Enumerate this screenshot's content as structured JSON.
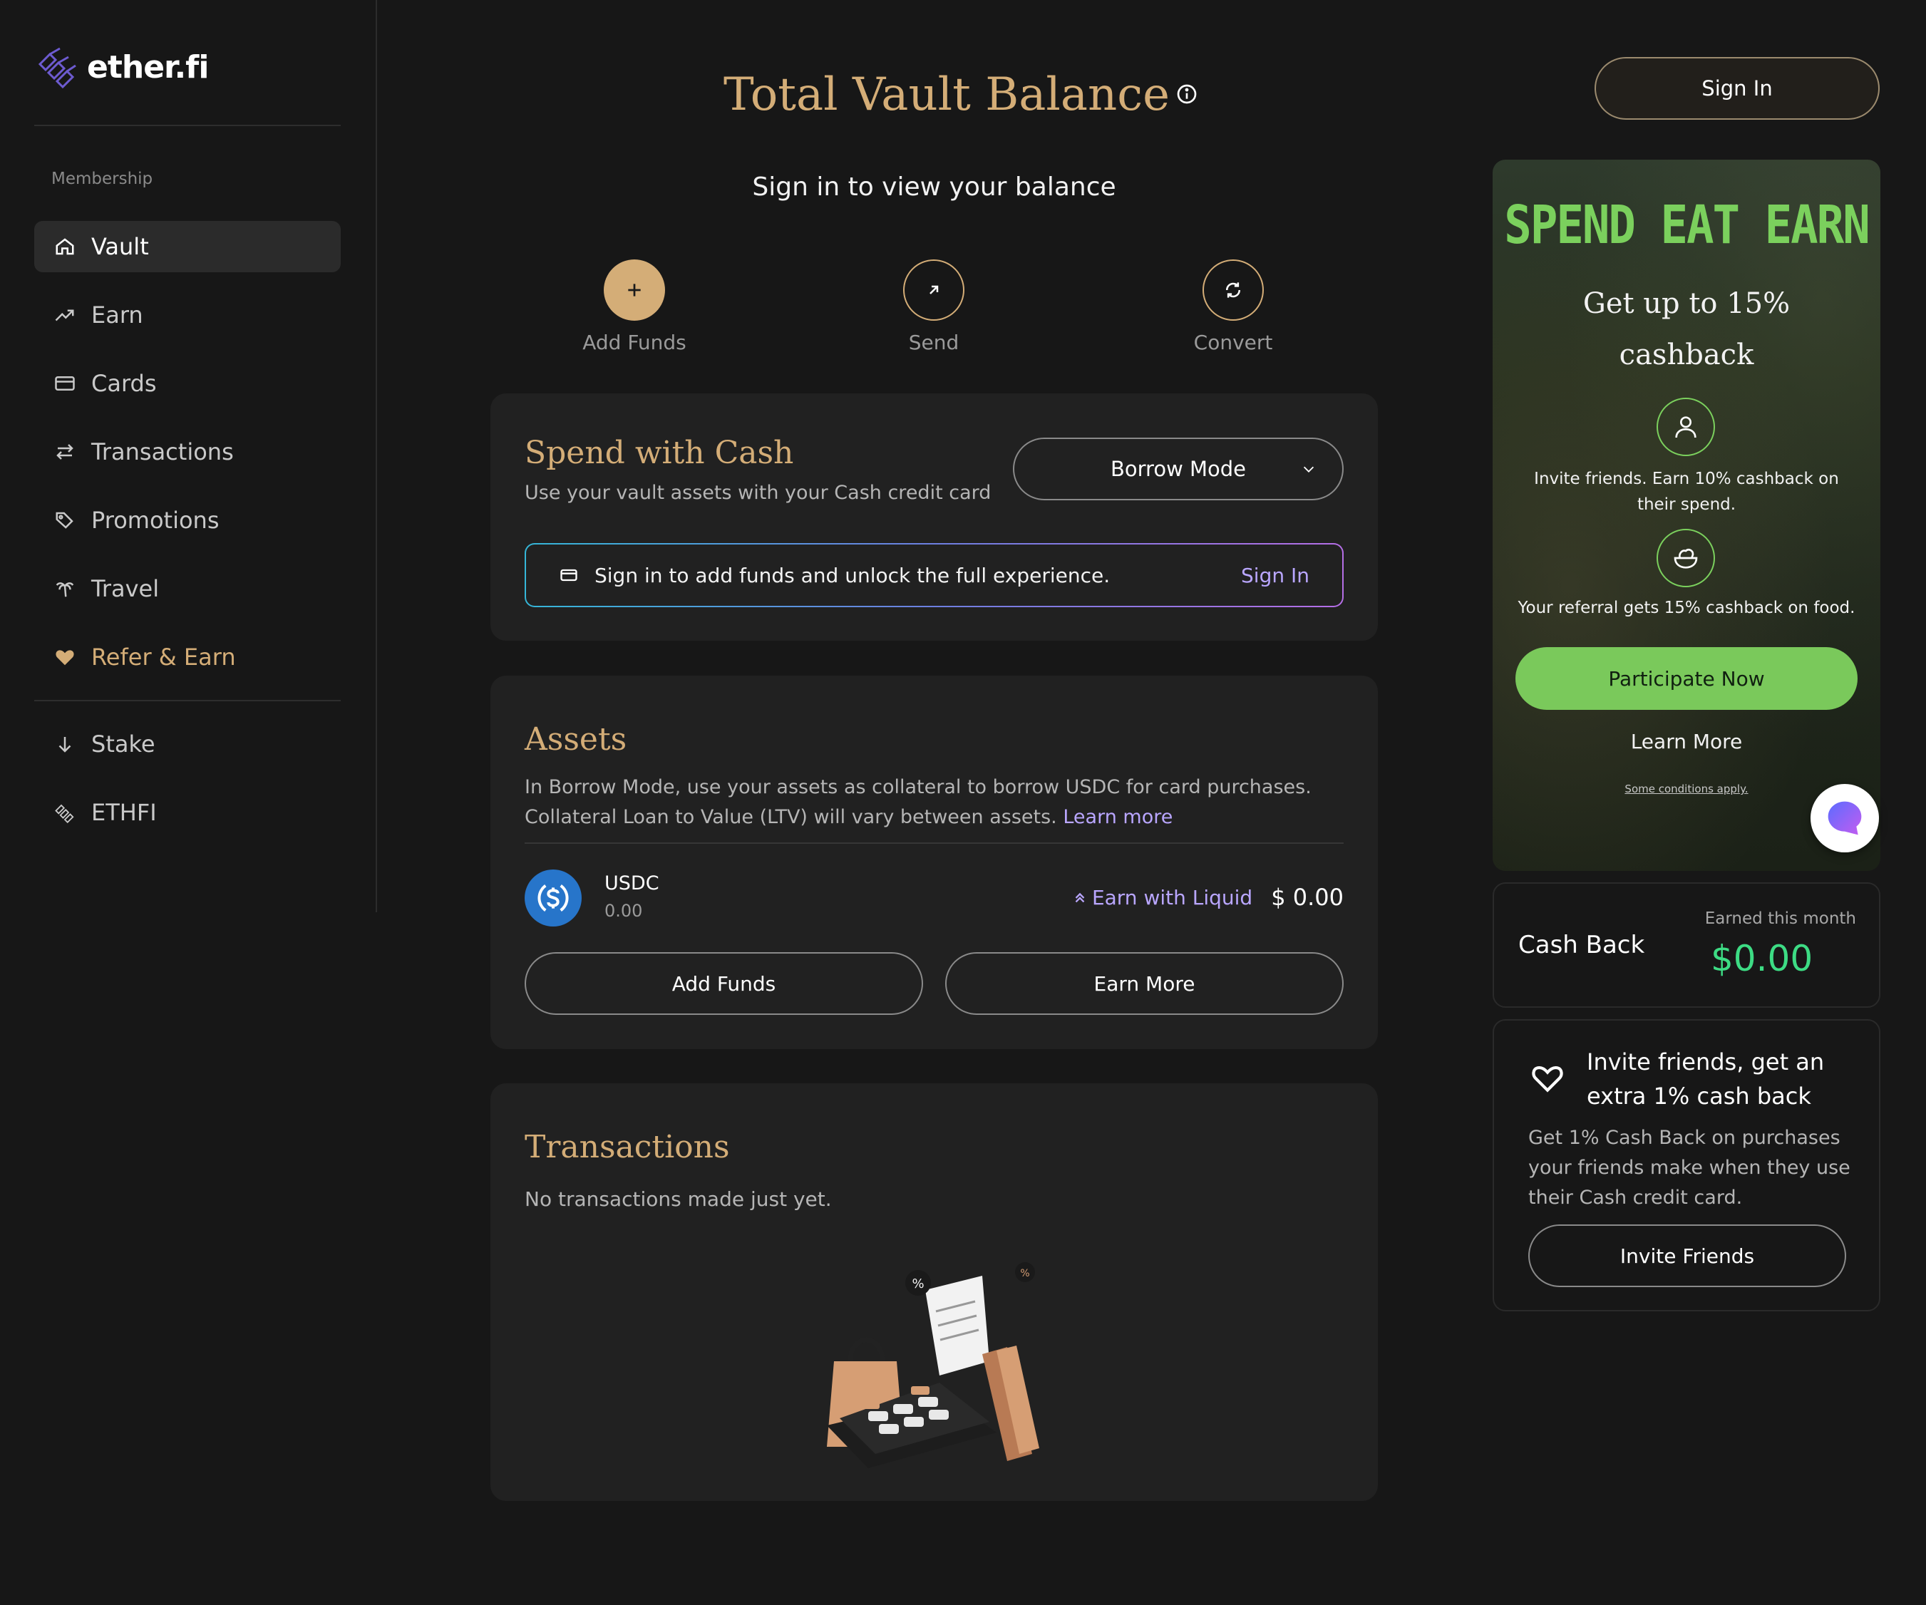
{
  "brand": {
    "name": "ether.fi"
  },
  "sidebar": {
    "section_label": "Membership",
    "items": [
      {
        "label": "Vault",
        "icon": "home-icon"
      },
      {
        "label": "Earn",
        "icon": "trending-up-icon"
      },
      {
        "label": "Cards",
        "icon": "credit-card-icon"
      },
      {
        "label": "Transactions",
        "icon": "arrows-swap-icon"
      },
      {
        "label": "Promotions",
        "icon": "tags-icon"
      },
      {
        "label": "Travel",
        "icon": "palm-tree-icon"
      },
      {
        "label": "Refer & Earn",
        "icon": "heart-icon"
      },
      {
        "label": "Stake",
        "icon": "arrow-down-icon"
      },
      {
        "label": "ETHFI",
        "icon": "ethfi-logo-icon"
      }
    ]
  },
  "header": {
    "title": "Total Vault Balance",
    "subtitle": "Sign in to view your balance",
    "sign_in": "Sign In"
  },
  "actions": [
    {
      "label": "Add Funds",
      "icon": "plus-icon"
    },
    {
      "label": "Send",
      "icon": "arrow-up-right-icon"
    },
    {
      "label": "Convert",
      "icon": "refresh-icon"
    }
  ],
  "spend": {
    "title": "Spend with Cash",
    "description": "Use your vault assets with your Cash credit card",
    "mode": "Borrow Mode",
    "banner_text": "Sign in to add funds and unlock the full experience.",
    "banner_link": "Sign In"
  },
  "assets": {
    "title": "Assets",
    "description": "In Borrow Mode, use your assets as collateral to borrow USDC for card purchases. Collateral Loan to Value (LTV) will vary between assets.",
    "learn_more": "Learn more",
    "items": [
      {
        "symbol": "USDC",
        "amount": "0.00",
        "earn_link": "Earn with Liquid",
        "value": "$ 0.00"
      }
    ],
    "add_funds": "Add Funds",
    "earn_more": "Earn More"
  },
  "transactions": {
    "title": "Transactions",
    "empty": "No transactions made just yet."
  },
  "promo": {
    "headline": "SPEND EAT EARN",
    "subhead": "Get up to 15% cashback",
    "point1": "Invite friends. Earn 10% cashback on their spend.",
    "point2": "Your referral gets 15% cashback on food.",
    "cta": "Participate Now",
    "learn_more": "Learn More",
    "fine_print": "Some conditions apply."
  },
  "cashback": {
    "label": "Cash Back",
    "period": "Earned this month",
    "value": "$0.00"
  },
  "invite": {
    "title": "Invite friends, get an extra 1% cash back",
    "description": "Get 1% Cash Back on purchases your friends make when they use their Cash credit card.",
    "cta": "Invite Friends"
  },
  "colors": {
    "gold": "#d4ad77",
    "green_cta": "#7ac95b",
    "cashback_green": "#3ddc84",
    "link_purple": "#b9a6ff"
  }
}
